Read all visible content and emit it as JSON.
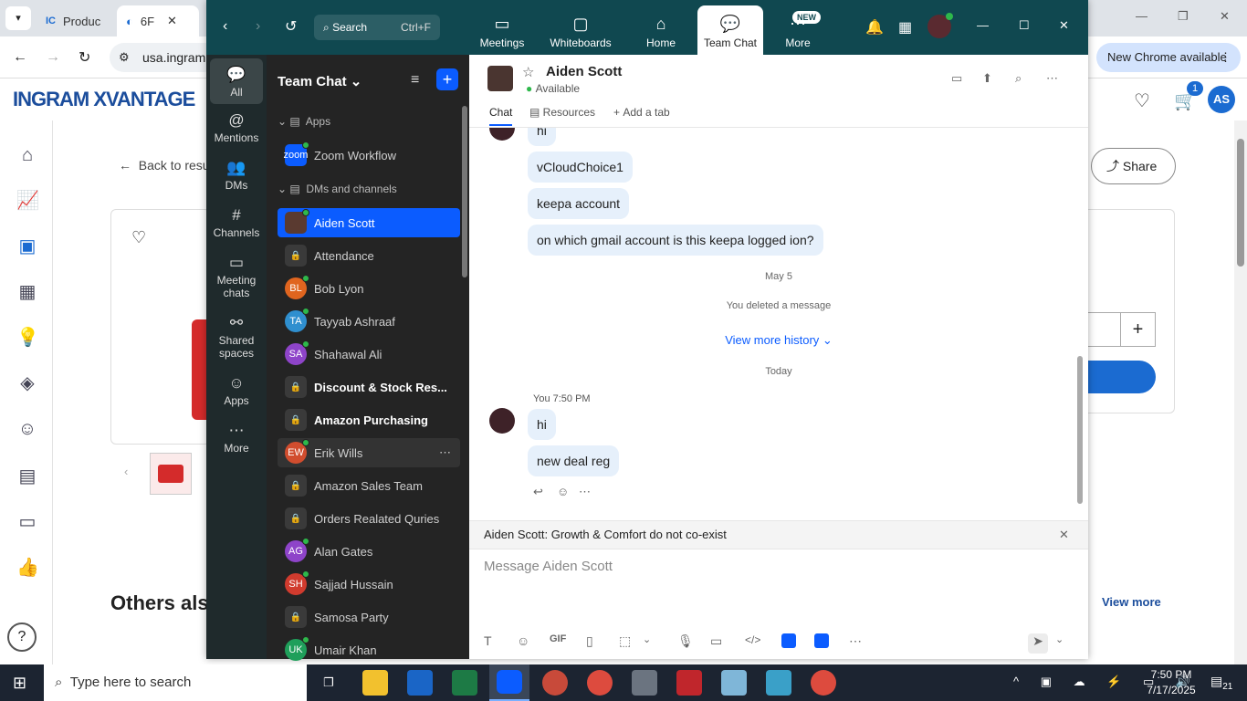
{
  "chrome": {
    "tabs": [
      {
        "label": "Produc"
      },
      {
        "label": "6F"
      }
    ],
    "url": "usa.ingram",
    "new_chrome": "New Chrome available",
    "profile": "AS",
    "cart_count": "1"
  },
  "site": {
    "logo": "INGRAM XVANTAGE",
    "back_label": "Back to resu",
    "share_label": "Share",
    "others_title": "Others als",
    "view_more": "View more"
  },
  "zoom": {
    "search_label": "Search",
    "search_shortcut": "Ctrl+F",
    "nav": [
      {
        "label": "Meetings"
      },
      {
        "label": "Whiteboards"
      },
      {
        "label": "Home"
      },
      {
        "label": "Team Chat"
      },
      {
        "label": "More"
      }
    ],
    "new_badge": "NEW",
    "rail": [
      {
        "label": "All"
      },
      {
        "label": "Mentions"
      },
      {
        "label": "DMs"
      },
      {
        "label": "Channels"
      },
      {
        "label": "Meeting chats"
      },
      {
        "label": "Shared spaces"
      },
      {
        "label": "Apps"
      },
      {
        "label": "More"
      }
    ],
    "panel_title": "Team Chat",
    "sections": {
      "apps": "Apps",
      "dms": "DMs and channels"
    },
    "list": [
      {
        "name": "Zoom Workflow",
        "avatar": "zoom",
        "color": "#0b5cff",
        "bold": false
      },
      {
        "name": "Aiden Scott",
        "avatar": "",
        "color": "#5a3a30",
        "bold": false
      },
      {
        "name": "Attendance",
        "avatar": "",
        "color": "#3a3a3a",
        "bold": false
      },
      {
        "name": "Bob Lyon",
        "avatar": "BL",
        "color": "#e0651f",
        "bold": false
      },
      {
        "name": "Tayyab Ashraaf",
        "avatar": "TA",
        "color": "#2f8fcf",
        "bold": false
      },
      {
        "name": "Shahawal Ali",
        "avatar": "SA",
        "color": "#8e44c9",
        "bold": false
      },
      {
        "name": "Discount & Stock Res...",
        "avatar": "",
        "color": "#3a3a3a",
        "bold": true
      },
      {
        "name": "Amazon Purchasing",
        "avatar": "",
        "color": "#3a3a3a",
        "bold": true
      },
      {
        "name": "Erik Wills",
        "avatar": "EW",
        "color": "#d14d2e",
        "bold": false
      },
      {
        "name": "Amazon Sales Team",
        "avatar": "",
        "color": "#3a3a3a",
        "bold": false
      },
      {
        "name": "Orders Realated Quries",
        "avatar": "",
        "color": "#3a3a3a",
        "bold": false
      },
      {
        "name": "Alan Gates",
        "avatar": "AG",
        "color": "#8e44c9",
        "bold": false
      },
      {
        "name": "Sajjad Hussain",
        "avatar": "SH",
        "color": "#d13b2e",
        "bold": false
      },
      {
        "name": "Samosa Party",
        "avatar": "",
        "color": "#3a3a3a",
        "bold": false
      },
      {
        "name": "Umair Khan",
        "avatar": "UK",
        "color": "#1f9f5a",
        "bold": false
      }
    ],
    "chat": {
      "contact": "Aiden Scott",
      "status": "Available",
      "tabs": [
        "Chat",
        "Resources",
        "Add a tab"
      ],
      "older_msgs": [
        "hi",
        "vCloudChoice1",
        "keepa account",
        "on which gmail account is this keepa logged ion?"
      ],
      "date1": "May 5",
      "deleted": "You deleted a message",
      "view_more": "View more history",
      "today": "Today",
      "sender": "You",
      "time": "7:50 PM",
      "new_msgs": [
        "hi",
        "new deal reg"
      ],
      "banner": "Aiden Scott: Growth & Comfort do not co-exist",
      "placeholder": "Message Aiden Scott",
      "gif": "GIF"
    }
  },
  "taskbar": {
    "search": "Type here to search",
    "time": "7:50 PM",
    "date": "7/17/2025",
    "notif_count": "21"
  }
}
